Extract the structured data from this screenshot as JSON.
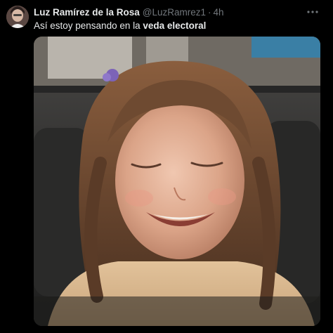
{
  "tweet": {
    "author": {
      "display_name": "Luz Ramírez de la Rosa",
      "handle": "@LuzRamrez1",
      "separator": "·",
      "timestamp": "4h"
    },
    "text": {
      "part1": "Así estoy pensando en la ",
      "part2_bold": "veda electoral"
    },
    "media": {
      "type": "photo",
      "alt": "Smiling girl with closed eyes meme"
    },
    "icons": {
      "avatar": "avatar-photo",
      "more": "more-horizontal-icon"
    }
  },
  "colors": {
    "background": "#000000",
    "text_primary": "#e7e9ea",
    "text_secondary": "#71767b"
  }
}
